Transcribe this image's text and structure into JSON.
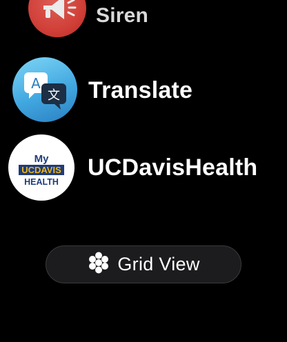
{
  "apps": [
    {
      "name": "Siren",
      "icon": "megaphone-icon",
      "color": "#e2453d"
    },
    {
      "name": "Translate",
      "icon": "translate-icon",
      "color": "#42a8e0",
      "glyph_latin": "A",
      "glyph_cjk": "文"
    },
    {
      "name": "UCDavisHealth",
      "icon": "ucdavis-health-logo",
      "color": "#ffffff",
      "logo_lines": [
        "My",
        "UCDAVIS",
        "HEALTH"
      ]
    }
  ],
  "grid_view_button": {
    "label": "Grid View",
    "icon": "grid-dots-icon"
  },
  "colors": {
    "background": "#000000",
    "ucdavis_blue": "#1f3c7a",
    "ucdavis_gold": "#f2b811"
  }
}
